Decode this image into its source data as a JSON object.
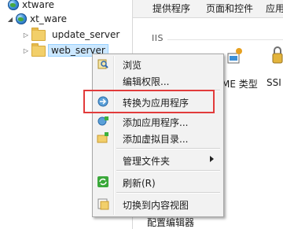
{
  "tree": {
    "items": [
      {
        "label": "xtware",
        "icon": "globe-icon"
      },
      {
        "label": "xt_ware",
        "icon": "globe-icon",
        "expanded": true
      },
      {
        "label": "update_server",
        "icon": "folder-icon"
      },
      {
        "label": "web_server",
        "icon": "folder-icon",
        "selected": true
      }
    ]
  },
  "right_pane": {
    "tabs": [
      "提供程序",
      "页面和控件",
      "应用"
    ],
    "section": "IIS",
    "features": [
      "ME 类型",
      "SSI"
    ],
    "bottom_label": "配置编辑器"
  },
  "context_menu": {
    "items": [
      {
        "label": "浏览",
        "icon": "browse-icon"
      },
      {
        "label": "编辑权限...",
        "icon": "none"
      },
      {
        "label": "转换为应用程序",
        "icon": "convert-app-icon",
        "highlighted": true
      },
      {
        "label": "添加应用程序...",
        "icon": "add-app-icon"
      },
      {
        "label": "添加虚拟目录...",
        "icon": "add-vdir-icon"
      },
      {
        "label": "管理文件夹",
        "icon": "none",
        "submenu": true
      },
      {
        "label": "刷新(R)",
        "icon": "refresh-icon"
      },
      {
        "label": "切换到内容视图",
        "icon": "content-view-icon"
      }
    ]
  },
  "colors": {
    "highlight_box": "#e23b3b",
    "selection_bg": "#cce8ff",
    "menu_bg": "#f2f2f2"
  }
}
